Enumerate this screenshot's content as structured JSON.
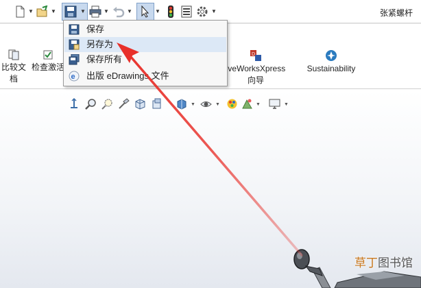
{
  "window": {
    "title": "张紧螺杆"
  },
  "quick_access": {
    "icons": [
      "new-icon",
      "open-icon",
      "save-icon",
      "print-icon",
      "undo-icon",
      "select-icon",
      "rebuild-icon",
      "file-properties-icon",
      "options-icon"
    ]
  },
  "ribbon": {
    "compare_label_1": "比较文",
    "compare_label_2": "档",
    "check_label": "检查激活",
    "driveworks_label_1": "iveWorksXpress",
    "driveworks_label_2": "向导",
    "sustainability_label": "Sustainability"
  },
  "save_menu": {
    "items": [
      {
        "label": "保存",
        "icon": "save-icon"
      },
      {
        "label": "另存为",
        "icon": "save-as-icon"
      },
      {
        "label": "保存所有",
        "icon": "save-all-icon"
      },
      {
        "label": "出版 eDrawings 文件",
        "icon": "edrawings-icon"
      }
    ]
  },
  "watermark": {
    "part1": "草丁",
    "part2": "图书馆"
  },
  "colors": {
    "arrow": "#e8302a",
    "menu_highlight": "#dce8f6"
  }
}
